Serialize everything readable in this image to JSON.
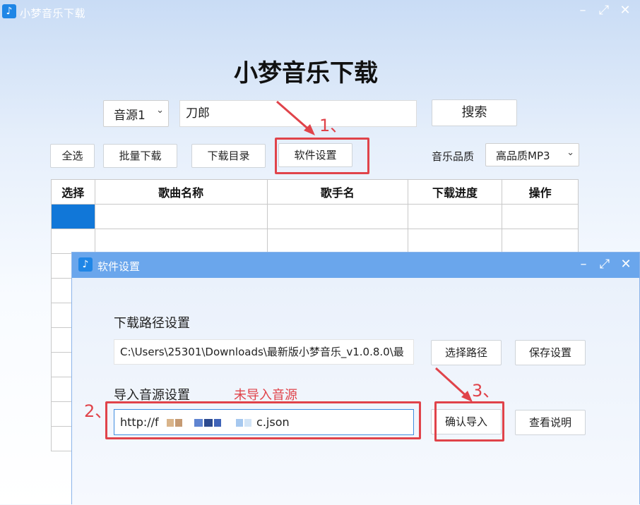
{
  "window": {
    "title": "小梦音乐下载",
    "icon": "music-note-icon"
  },
  "header": {
    "title": "小梦音乐下载"
  },
  "search": {
    "source": "音源1",
    "query": "刀郎",
    "button": "搜索"
  },
  "toolbar": {
    "select_all": "全选",
    "batch_download": "批量下载",
    "download_dir": "下载目录",
    "settings": "软件设置",
    "quality_label": "音乐品质",
    "quality_value": "高品质MP3"
  },
  "table": {
    "columns": [
      "选择",
      "歌曲名称",
      "歌手名",
      "下载进度",
      "操作"
    ]
  },
  "dialog": {
    "title": "软件设置",
    "path_label": "下载路径设置",
    "path_value": "C:\\Users\\25301\\Downloads\\最新版小梦音乐_v1.0.8.0\\最",
    "choose_path": "选择路径",
    "save_settings": "保存设置",
    "import_label": "导入音源设置",
    "import_status": "未导入音源",
    "import_url_prefix": "http://f",
    "import_url_suffix": "c.json",
    "confirm_import": "确认导入",
    "view_help": "查看说明"
  },
  "annotations": {
    "a1": "1、",
    "a2": "2、",
    "a3": "3、"
  },
  "colors": {
    "annotation": "#e0434a",
    "selection": "#1177d8",
    "dialog_title": "#6aa6ec"
  }
}
